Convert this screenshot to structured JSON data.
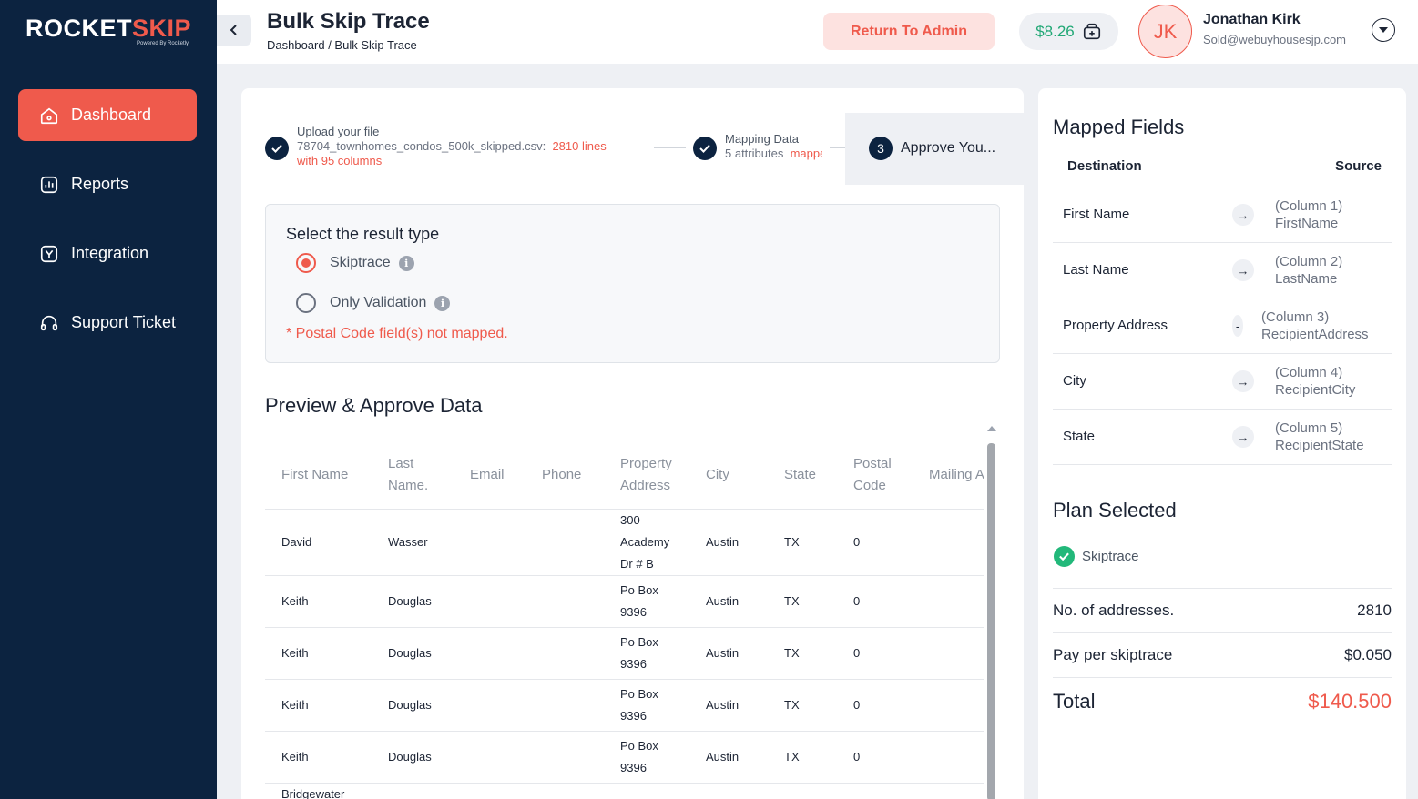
{
  "brand": {
    "logo_main": "ROCKET",
    "logo_accent": "SKIP",
    "logo_sub": "Powered By Rocketly"
  },
  "sidebar": {
    "items": [
      {
        "label": "Dashboard",
        "icon": "home-icon",
        "active": true
      },
      {
        "label": "Reports",
        "icon": "reports-icon",
        "active": false
      },
      {
        "label": "Integration",
        "icon": "integration-icon",
        "active": false
      },
      {
        "label": "Support Ticket",
        "icon": "headset-icon",
        "active": false
      }
    ]
  },
  "header": {
    "title": "Bulk Skip Trace",
    "breadcrumb": "Dashboard / Bulk Skip Trace",
    "return_label": "Return To Admin",
    "balance": "$8.26",
    "avatar_initials": "JK",
    "user_name": "Jonathan Kirk",
    "user_email": "Sold@webuyhousesjp.com"
  },
  "steps": {
    "step1_title": "Upload your file",
    "step1_file": "78704_townhomes_condos_500k_skipped.csv:",
    "step1_lines": "2810 lines",
    "step1_cols": "with 95 columns",
    "step2_title": "Mapping Data",
    "step2_sub": "5 attributes",
    "step2_sub_red": "mapped",
    "step3_num": "3",
    "step3_label": "Approve You..."
  },
  "result_type": {
    "title": "Select the result type",
    "option1": "Skiptrace",
    "option2": "Only Validation",
    "selected": "Skiptrace",
    "warning": "* Postal Code field(s) not mapped."
  },
  "preview": {
    "title": "Preview & Approve Data",
    "columns": [
      "First Name",
      "Last Name.",
      "Email",
      "Phone",
      "Property Address",
      "City",
      "State",
      "Postal Code",
      "Mailing Address"
    ],
    "rows": [
      [
        "David",
        "Wasser",
        "",
        "",
        "300 Academy Dr # B",
        "Austin",
        "TX",
        "0",
        ""
      ],
      [
        "Keith",
        "Douglas",
        "",
        "",
        "Po Box 9396",
        "Austin",
        "TX",
        "0",
        ""
      ],
      [
        "Keith",
        "Douglas",
        "",
        "",
        "Po Box 9396",
        "Austin",
        "TX",
        "0",
        ""
      ],
      [
        "Keith",
        "Douglas",
        "",
        "",
        "Po Box 9396",
        "Austin",
        "TX",
        "0",
        ""
      ],
      [
        "Keith",
        "Douglas",
        "",
        "",
        "Po Box 9396",
        "Austin",
        "TX",
        "0",
        ""
      ],
      [
        "Bridgewater",
        "",
        "",
        "",
        "",
        "",
        "",
        "",
        ""
      ]
    ]
  },
  "mapped": {
    "title": "Mapped Fields",
    "dest_header": "Destination",
    "src_header": "Source",
    "fields": [
      {
        "dest": "First Name",
        "col": "(Column 1)",
        "src": "FirstName"
      },
      {
        "dest": "Last Name",
        "col": "(Column 2)",
        "src": "LastName"
      },
      {
        "dest": "Property Address",
        "col": "(Column 3)",
        "src": "RecipientAddress"
      },
      {
        "dest": "City",
        "col": "(Column 4)",
        "src": "RecipientCity"
      },
      {
        "dest": "State",
        "col": "(Column 5)",
        "src": "RecipientState"
      }
    ]
  },
  "plan": {
    "title": "Plan Selected",
    "item": "Skiptrace",
    "addresses_label": "No. of addresses.",
    "addresses_value": "2810",
    "pay_label": "Pay per skiptrace",
    "pay_value": "$0.050",
    "total_label": "Total",
    "total_value": "$140.500"
  },
  "colors": {
    "sidebar": "#0c2340",
    "accent": "#ef5a4c",
    "green": "#22a876"
  }
}
